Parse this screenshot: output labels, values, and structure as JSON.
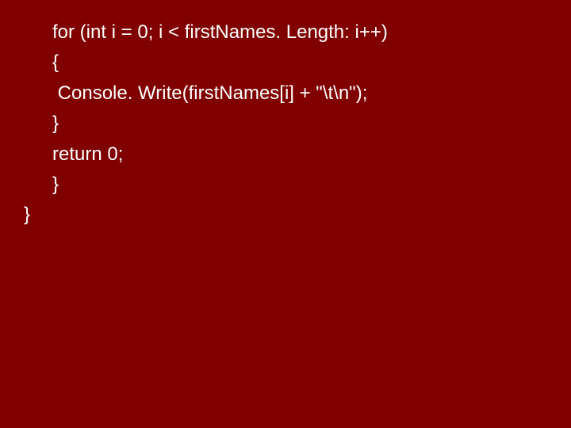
{
  "code": {
    "lines": [
      {
        "indent": 1,
        "text": "for (int i = 0; i < firstNames. Length: i++)"
      },
      {
        "indent": 1,
        "text": "{"
      },
      {
        "indent": 1,
        "text": " Console. Write(firstNames[i] + \"\\t\\n\");"
      },
      {
        "indent": 1,
        "text": "}"
      },
      {
        "indent": 1,
        "text": "return 0;"
      },
      {
        "indent": 1,
        "text": "}"
      },
      {
        "indent": 0,
        "text": "}"
      }
    ]
  }
}
